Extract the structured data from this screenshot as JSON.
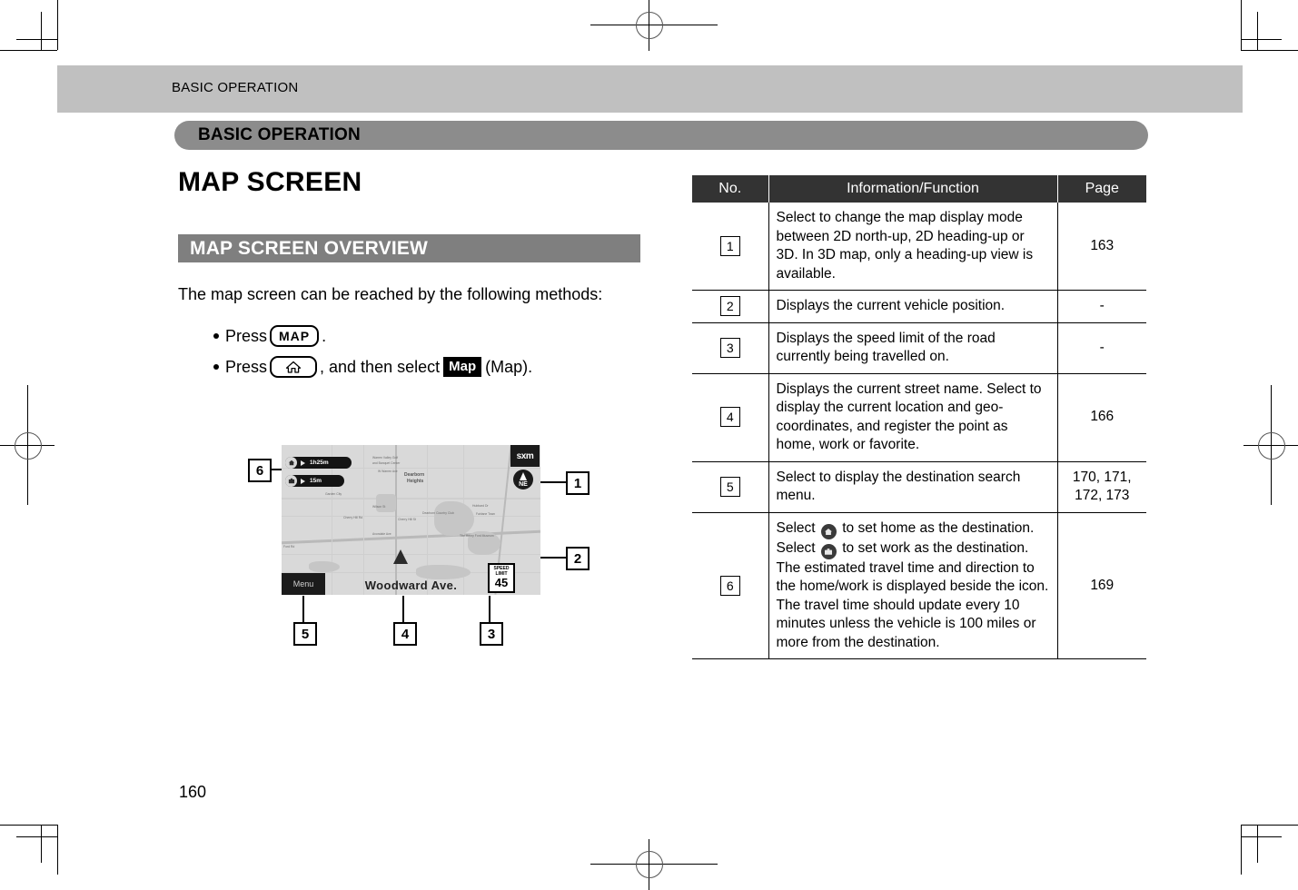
{
  "header": {
    "breadcrumb": "BASIC OPERATION",
    "chapter_pill": "BASIC OPERATION"
  },
  "left": {
    "page_title": "MAP SCREEN",
    "section_title": "MAP SCREEN OVERVIEW",
    "intro": "The map screen can be reached by the following methods:",
    "bullets": [
      {
        "pre": "Press",
        "key": "MAP",
        "post": "."
      },
      {
        "pre": "Press",
        "key_icon": "home-icon",
        "mid": ", and then select",
        "chip": "Map",
        "post": "(Map)."
      }
    ]
  },
  "figure": {
    "map": {
      "sxm_logo": "sxm",
      "compass_direction": "NE",
      "menu_button": "Menu",
      "street_name": "Woodward Ave.",
      "speed_limit": {
        "line1": "SPEED",
        "line2": "LIMIT",
        "value": "45"
      },
      "eta_badges": [
        {
          "icon": "home-icon",
          "time": "1h25m"
        },
        {
          "icon": "work-icon",
          "time": "15m"
        }
      ],
      "labels": [
        "Warren Valley Golf",
        "and Banquet Center",
        "W Warren Ave",
        "Dearborn",
        "Heights",
        "Garden City",
        "Wilson St",
        "Cherry Hill Rd",
        "Cherry Hill St",
        "Avondale Ave",
        "Dearborn Country Club",
        "Hubbard Dr",
        "Fairlane Town",
        "The Henry Ford Museum",
        "Ford Rd"
      ]
    },
    "callouts": [
      "1",
      "2",
      "3",
      "4",
      "5",
      "6"
    ]
  },
  "table": {
    "headers": [
      "No.",
      "Information/Function",
      "Page"
    ],
    "rows": [
      {
        "no": "1",
        "text": "Select to change the map display mode between 2D north-up, 2D heading-up or 3D. In 3D map, only a heading-up view is available.",
        "page": "163"
      },
      {
        "no": "2",
        "text": "Displays the current vehicle position.",
        "page": "-"
      },
      {
        "no": "3",
        "text": "Displays the speed limit of the road currently being travelled on.",
        "page": "-"
      },
      {
        "no": "4",
        "text": "Displays the current street name. Select to display the current location and geo-coordinates, and register the point as home, work or favorite.",
        "page": "166"
      },
      {
        "no": "5",
        "text": "Select to display the destination search menu.",
        "page": "170, 171, 172, 173"
      },
      {
        "no": "6",
        "text_parts": {
          "p1": "Select",
          "p2": "to set home as the destination.",
          "p3": "Select",
          "p4": "to set work as the destination. The estimated travel time and direction to the home/work is displayed beside the icon. The travel time should update every 10 minutes unless the vehicle is 100 miles or more from the destination."
        },
        "page": "169"
      }
    ]
  },
  "footer": {
    "page_number": "160"
  },
  "colors": {
    "band_gray": "#c0c0c0",
    "pill_gray": "#8c8c8c",
    "section_gray": "#7f7f7f",
    "table_header": "#333333"
  }
}
